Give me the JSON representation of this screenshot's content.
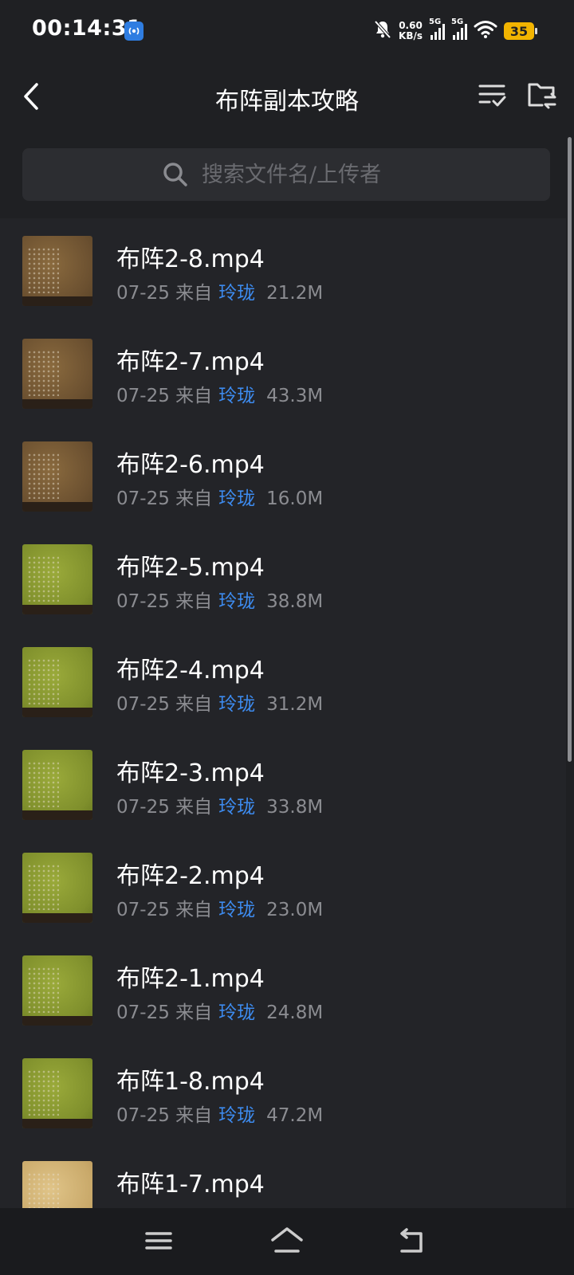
{
  "status_bar": {
    "time": "00:14:31",
    "net_speed_value": "0.60",
    "net_speed_unit": "KB/s",
    "sim1_label": "5G",
    "sim2_label": "5G",
    "battery_level": "35",
    "icons": [
      "hotspot-icon",
      "mute-bell-icon",
      "signal-icon",
      "wifi-icon",
      "battery-icon"
    ]
  },
  "header": {
    "title": "布阵副本攻略",
    "icons": [
      "back-chevron-icon",
      "sort-list-icon",
      "folder-transfer-icon"
    ]
  },
  "search": {
    "placeholder": "搜索文件名/上传者"
  },
  "colors": {
    "background": "#1f2023",
    "list_background": "#232428",
    "uploader_link": "#3d8bef",
    "battery": "#f2b400"
  },
  "files": [
    {
      "name": "布阵2-8.mp4",
      "date": "07-25",
      "from_label": "来自",
      "uploader": "玲珑",
      "size": "21.2M",
      "thumb": "brown"
    },
    {
      "name": "布阵2-7.mp4",
      "date": "07-25",
      "from_label": "来自",
      "uploader": "玲珑",
      "size": "43.3M",
      "thumb": "brown"
    },
    {
      "name": "布阵2-6.mp4",
      "date": "07-25",
      "from_label": "来自",
      "uploader": "玲珑",
      "size": "16.0M",
      "thumb": "brown"
    },
    {
      "name": "布阵2-5.mp4",
      "date": "07-25",
      "from_label": "来自",
      "uploader": "玲珑",
      "size": "38.8M",
      "thumb": "green"
    },
    {
      "name": "布阵2-4.mp4",
      "date": "07-25",
      "from_label": "来自",
      "uploader": "玲珑",
      "size": "31.2M",
      "thumb": "green"
    },
    {
      "name": "布阵2-3.mp4",
      "date": "07-25",
      "from_label": "来自",
      "uploader": "玲珑",
      "size": "33.8M",
      "thumb": "green"
    },
    {
      "name": "布阵2-2.mp4",
      "date": "07-25",
      "from_label": "来自",
      "uploader": "玲珑",
      "size": "23.0M",
      "thumb": "green"
    },
    {
      "name": "布阵2-1.mp4",
      "date": "07-25",
      "from_label": "来自",
      "uploader": "玲珑",
      "size": "24.8M",
      "thumb": "green"
    },
    {
      "name": "布阵1-8.mp4",
      "date": "07-25",
      "from_label": "来自",
      "uploader": "玲珑",
      "size": "47.2M",
      "thumb": "green"
    },
    {
      "name": "布阵1-7.mp4",
      "date": "",
      "from_label": "",
      "uploader": "",
      "size": "",
      "thumb": "sand"
    }
  ],
  "nav_bar": {
    "icons": [
      "menu-icon",
      "home-icon",
      "back-icon"
    ]
  }
}
